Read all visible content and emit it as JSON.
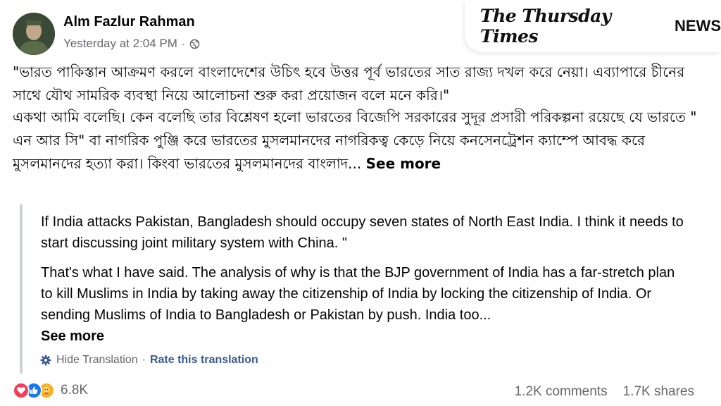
{
  "post": {
    "author": "Alm Fazlur Rahman",
    "timestamp": "Yesterday at 2:04 PM",
    "separator": "·",
    "audience_icon": "globe-icon"
  },
  "watermark": {
    "script_text": "The Thursday Times",
    "news_text": "NEWS"
  },
  "original": {
    "paragraph1": "\"ভারত পাকিস্তান আক্রমণ করলে বাংলাদেশের উচিৎ হবে উত্তর পূর্ব ভারতের সাত রাজ্য দখল করে নেয়া। এব্যাপারে চীনের সাথে যৌথ সামরিক ব্যবস্থা নিয়ে আলোচনা শুরু করা প্রয়োজন বলে মনে করি।\"",
    "paragraph2": "একথা আমি বলেছি। কেন বলেছি তার বিশ্লেষণ হলো ভারতের বিজেপি সরকারের সুদূর প্রসারী পরিকল্পনা রয়েছে যে ভারতে \" এন আর সি\" বা নাগরিক পুঞ্জি করে ভারতের মুসলমানদের নাগরিকত্ব কেড়ে নিয়ে কনসেনট্রেশন ক্যাম্পে আবদ্ধ করে মুসলমানদের হত্যা করা। কিংবা ভারতের মুসলমানদের বাংলাদ...",
    "see_more": "See more"
  },
  "translation": {
    "paragraph1": "If India attacks Pakistan, Bangladesh should occupy seven states of North East India. I think it needs to start discussing joint military system with China. \"",
    "paragraph2": "That's what I have said. The analysis of why is that the BJP government of India has a far-stretch plan to kill Muslims in India by taking away the citizenship of India by locking the citizenship of India. Or sending Muslims of India to Bangladesh or Pakistan by push. India too...",
    "see_more": "See more",
    "hide_label": "Hide Translation",
    "separator": "·",
    "rate_label": "Rate this translation"
  },
  "footer": {
    "reaction_icons": [
      "love-icon",
      "like-icon",
      "care-icon"
    ],
    "reaction_count": "6.8K",
    "comments": "1.2K comments",
    "shares": "1.7K shares"
  },
  "colors": {
    "link_blue": "#385898",
    "secondary_text": "#65676b",
    "like_blue": "#1877f2",
    "love_red": "#f33e58",
    "care_yellow": "#f7b125"
  }
}
